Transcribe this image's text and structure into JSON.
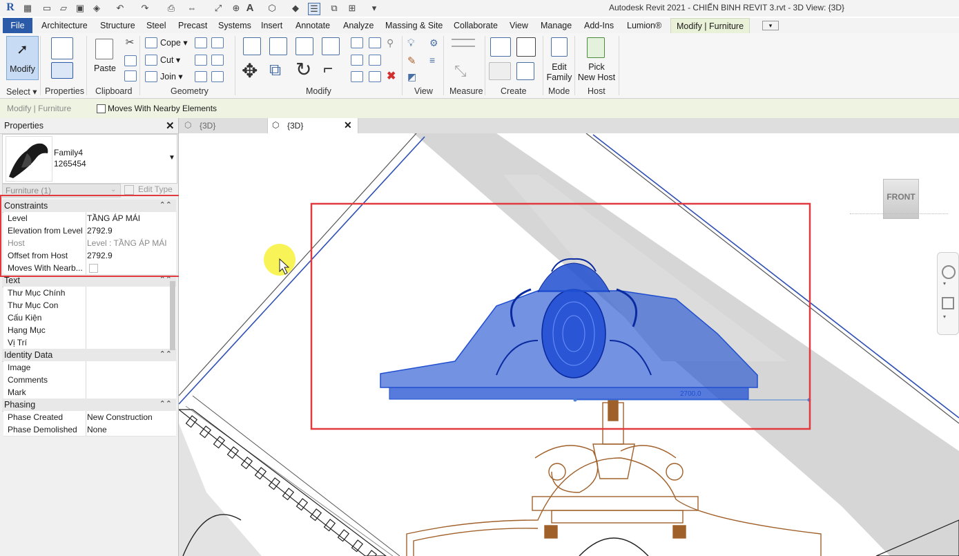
{
  "window": {
    "title": "Autodesk Revit 2021 - CHIẾN BINH REVIT 3.rvt - 3D View: {3D}",
    "app_logo": "R"
  },
  "ribbon_tabs": [
    "File",
    "Architecture",
    "Structure",
    "Steel",
    "Precast",
    "Systems",
    "Insert",
    "Annotate",
    "Analyze",
    "Massing & Site",
    "Collaborate",
    "View",
    "Manage",
    "Add-Ins",
    "Lumion®",
    "Modify | Furniture"
  ],
  "ribbon": {
    "select": {
      "button": "Modify",
      "panel": "Select"
    },
    "properties": {
      "panel": "Properties"
    },
    "clipboard": {
      "paste": "Paste",
      "panel": "Clipboard"
    },
    "geometry": {
      "cope": "Cope",
      "cut": "Cut",
      "join": "Join",
      "panel": "Geometry"
    },
    "modify": {
      "panel": "Modify"
    },
    "view": {
      "panel": "View"
    },
    "measure": {
      "panel": "Measure"
    },
    "create": {
      "panel": "Create"
    },
    "mode": {
      "edit_family_line1": "Edit",
      "edit_family_line2": "Family",
      "panel": "Mode"
    },
    "host": {
      "pick_line1": "Pick",
      "pick_line2": "New Host",
      "panel": "Host"
    }
  },
  "options_bar": {
    "context": "Modify | Furniture",
    "moves_with_nearby": "Moves With Nearby Elements",
    "moves_checked": false
  },
  "properties": {
    "title": "Properties",
    "family_name": "Family4",
    "family_id": "1265454",
    "selector": "Furniture (1)",
    "edit_type": "Edit Type",
    "groups": [
      {
        "name": "Constraints",
        "rows": [
          {
            "name": "Level",
            "value": "TẦNG ÁP MÁI",
            "dim": false
          },
          {
            "name": "Elevation from Level",
            "value": "2792.9",
            "dim": false
          },
          {
            "name": "Host",
            "value": "Level : TẦNG ÁP MÁI",
            "dim": true
          },
          {
            "name": "Offset from Host",
            "value": "2792.9",
            "dim": false
          },
          {
            "name": "Moves With Nearb...",
            "value": "",
            "dim": false,
            "checkbox": true
          }
        ]
      },
      {
        "name": "Text",
        "rows": [
          {
            "name": "Thư Mục Chính",
            "value": ""
          },
          {
            "name": "Thư Mục Con",
            "value": ""
          },
          {
            "name": "Cấu Kiện",
            "value": ""
          },
          {
            "name": "Hạng Mục",
            "value": ""
          },
          {
            "name": "Vị Trí",
            "value": ""
          }
        ]
      },
      {
        "name": "Identity Data",
        "rows": [
          {
            "name": "Image",
            "value": ""
          },
          {
            "name": "Comments",
            "value": ""
          },
          {
            "name": "Mark",
            "value": ""
          }
        ]
      },
      {
        "name": "Phasing",
        "rows": [
          {
            "name": "Phase Created",
            "value": "New Construction"
          },
          {
            "name": "Phase Demolished",
            "value": "None"
          }
        ]
      }
    ]
  },
  "view_tabs": [
    {
      "label": "{3D}",
      "active": false
    },
    {
      "label": "{3D}",
      "active": true
    }
  ],
  "viewport": {
    "viewcube_face": "FRONT",
    "dimension_label": "2700.0"
  },
  "colors": {
    "accent_blue": "#2a5aa8",
    "selection_blue": "#1f4fd0",
    "highlight_red": "#e0393e",
    "context_green": "#eaf1d9",
    "wood_brown": "#a0602a"
  }
}
